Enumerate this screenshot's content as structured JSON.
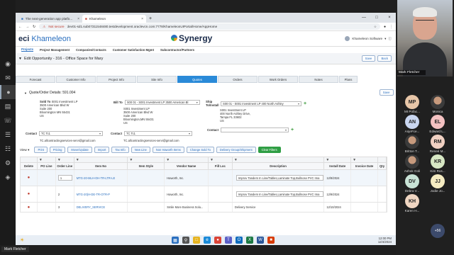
{
  "browser": {
    "tabs": [
      {
        "label": "The next-generation app platfo...",
        "active": false
      },
      {
        "label": "Khameleon",
        "active": true
      }
    ],
    "not_secure": "Not secure",
    "url": "dev01-sd1.sub07311548480.testdevelopment.oraclevcn.com:7778/KhameleonUIPortal/Home/AppHome"
  },
  "app": {
    "brand_prefix": "eci",
    "brand_name": "Khameleon",
    "product": "Synergy",
    "user": "Khameleon Software",
    "nav": [
      "Projects",
      "Project Management",
      "Companies/Contacts",
      "Customer Satisfaction Mgmt",
      "Subcontractor/Partners"
    ],
    "page_title": "Edit Opportunity - 316 - Office Space for Mary",
    "save_label": "Save",
    "back_label": "Back",
    "tabs": [
      "Forecast",
      "Customer Info",
      "Project Info",
      "Site Info",
      "Quotes",
      "Orders",
      "Work Orders",
      "Notes",
      "Plans"
    ],
    "active_tab": "Quotes",
    "quote_detail": "Quote/Order Details: 591.004",
    "quote_buttons": [
      "Save",
      "Print",
      "Expand"
    ],
    "sold_to": {
      "label": "Sold To",
      "name": "S001 Investment LP",
      "lines": [
        "3500 American Blvd W",
        "Suite 200",
        "Bloomington MN 55431",
        "US"
      ]
    },
    "bill_to": {
      "label": "Bill To",
      "select": "S00 01 - S001 Investment LP  3500 American Bl",
      "lines": [
        "S001 Investment LP",
        "3500 American Blvd W",
        "Suite 200",
        "Bloomington,MN 55431",
        "US"
      ]
    },
    "ship_to": {
      "label": "Ship To/Install",
      "select": "S00 01 - S001 Investment LP  400 North Ashley",
      "lines": [
        "S001 Investment LP",
        "400 North Ashley Drive,",
        "Tampa FL 33602",
        "US"
      ]
    },
    "contact_label": "Contact",
    "contact_1": "TC Tc1",
    "contact_1_email": "TC.allcontractingservices-servi@gmail.com",
    "contact_2": "TC Tc1",
    "contact_2_email": "TC.allcontractingservices-servi@gmail.com",
    "contact_3_label": "Contact",
    "view_label": "View",
    "action_buttons": [
      "Print",
      "Pricing",
      "Move/Update",
      "Import",
      "Tax Info",
      "New Line",
      "Non Haworth Items",
      "Change Sold To",
      "Delivery Group/Shipment",
      "Clear Filters"
    ],
    "grid": {
      "columns": [
        "Delete",
        "PO Line",
        "Order Line",
        "Item No",
        "Item Style",
        "Vendor Name",
        "Fill Loc",
        "Description",
        "Install Date",
        "Invoice Date",
        "Qty"
      ],
      "rows": [
        {
          "order_line": "1",
          "item_no": "MTG-20-MLH-OH-TR-LTR-LE",
          "vendor": "Haworth, Inc.",
          "description": "Improv Tandem In Line/Tables,Laminate Top,Bullnose PVC Ima",
          "install": "12/9/2024"
        },
        {
          "order_line": "2",
          "item_no": "MTG-20(H-DE-TR-OTR-P",
          "vendor": "Haworth, Inc.",
          "description": "Improv Tandem In Line/Tables,Laminate Top,Bullnose PVC Ima",
          "install": "12/9/2024"
        },
        {
          "order_line": "3",
          "item_no": "DELIVERY_SERVICE",
          "vendor": "Smile More Business Solu...",
          "description": "Delivery Service",
          "install": "12/10/2024"
        }
      ]
    }
  },
  "taskbar": {
    "time": "12:00 PM",
    "date": "12/4/2024"
  },
  "meeting": {
    "presenter": "Mark Fletcher",
    "speaker": "Mark Fletcher",
    "participants": [
      {
        "initials": "MP",
        "name": "MI Pofac...",
        "color": "#e7c6a8"
      },
      {
        "initials": "",
        "name": "Monica",
        "color": "photo"
      },
      {
        "initials": "AN",
        "name": "AnjeFce...",
        "color": "#c9d6f0"
      },
      {
        "initials": "EL",
        "name": "Edward L...",
        "color": "#f4c2c2"
      },
      {
        "initials": "",
        "name": "Britton T...",
        "color": "photo"
      },
      {
        "initials": "RM",
        "name": "Reneé M...",
        "color": "#f0d0c2"
      },
      {
        "initials": "",
        "name": "Ashok Goli",
        "color": "photo"
      },
      {
        "initials": "KR",
        "name": "Kim Ros...",
        "color": "#d7e7c4"
      },
      {
        "initials": "DV",
        "name": "Debra V...",
        "color": "#c9e3d6"
      },
      {
        "initials": "JJ",
        "name": "Jodie Jo...",
        "color": "#f5ecc2"
      },
      {
        "initials": "KH",
        "name": "Karen H...",
        "color": "#f0d6c2"
      }
    ],
    "more": "+56"
  }
}
